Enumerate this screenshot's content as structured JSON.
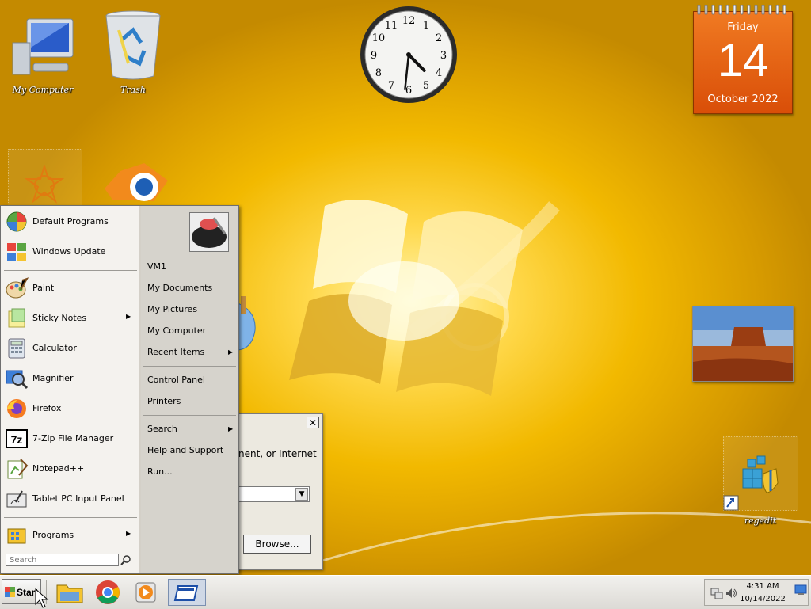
{
  "desktop": {
    "icons": [
      {
        "label": "My Computer",
        "icon": "computer-icon"
      },
      {
        "label": "Trash",
        "icon": "recycle-bin-icon"
      },
      {
        "label": "regedit",
        "icon": "regedit-icon"
      }
    ]
  },
  "clock": {
    "numbers": [
      "12",
      "1",
      "2",
      "3",
      "4",
      "5",
      "6",
      "7",
      "8",
      "9",
      "10",
      "11"
    ],
    "hour": 4,
    "minute": 31
  },
  "calendar": {
    "weekday": "Friday",
    "day": "14",
    "month_year": "October 2022"
  },
  "run_dialog": {
    "visible_text": "nent, or Internet",
    "browse_label": "Browse...",
    "close_label": "✕"
  },
  "start_menu": {
    "pinned": [
      {
        "label": "Default Programs",
        "icon": "default-programs-icon"
      },
      {
        "label": "Windows Update",
        "icon": "windows-update-icon"
      }
    ],
    "recent": [
      {
        "label": "Paint",
        "icon": "paint-icon"
      },
      {
        "label": "Sticky Notes",
        "icon": "sticky-notes-icon",
        "has_submenu": true
      },
      {
        "label": "Calculator",
        "icon": "calculator-icon"
      },
      {
        "label": "Magnifier",
        "icon": "magnifier-icon"
      },
      {
        "label": "Firefox",
        "icon": "firefox-icon"
      },
      {
        "label": "7-Zip File Manager",
        "icon": "7zip-icon"
      },
      {
        "label": "Notepad++",
        "icon": "notepadpp-icon"
      },
      {
        "label": "Tablet PC Input Panel",
        "icon": "tablet-input-icon"
      }
    ],
    "programs_label": "Programs",
    "search_placeholder": "Search",
    "right_panel": {
      "user": "VM1",
      "group1": [
        "My Documents",
        "My Pictures",
        "My Computer",
        "Recent Items"
      ],
      "group2": [
        "Control Panel",
        "Printers"
      ],
      "group3": [
        "Search",
        "Help and Support",
        "Run..."
      ]
    }
  },
  "taskbar": {
    "start_label": "Start",
    "pinned": [
      {
        "name": "file-manager",
        "icon": "folder-icon"
      },
      {
        "name": "chrome",
        "icon": "chrome-icon"
      },
      {
        "name": "media-player",
        "icon": "media-player-icon"
      },
      {
        "name": "window-switcher",
        "icon": "window-icon"
      }
    ],
    "time": "4:31 AM",
    "date": "10/14/2022"
  },
  "colors": {
    "desktop": "#f2b900",
    "calendar": "#e8661a",
    "start_menu": "#d4d0c8"
  }
}
